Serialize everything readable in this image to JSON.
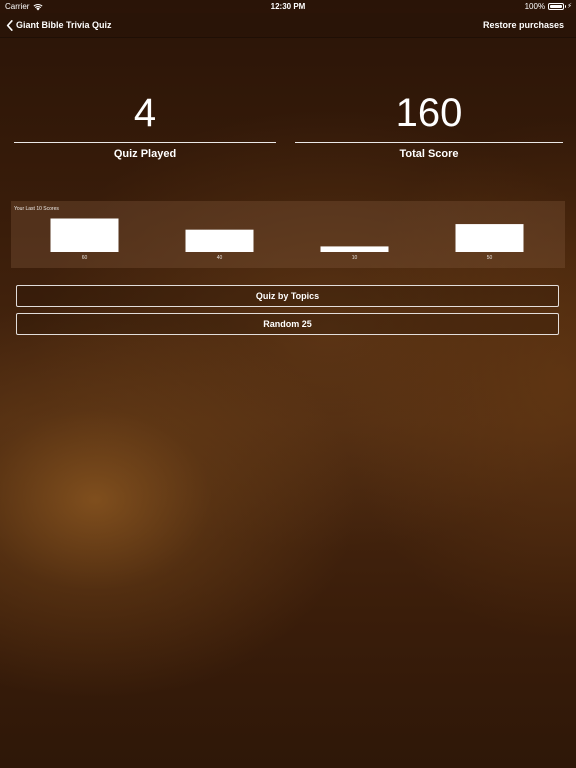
{
  "status_bar": {
    "carrier": "Carrier",
    "time": "12:30 PM",
    "battery": "100%"
  },
  "nav": {
    "back_label": "Giant Bible Trivia Quiz",
    "action_label": "Restore purchases"
  },
  "stats": {
    "quiz_played": {
      "value": "4",
      "label": "Quiz Played"
    },
    "total_score": {
      "value": "160",
      "label": "Total Score"
    }
  },
  "scores_panel": {
    "title": "Your Last 10 Scores"
  },
  "chart_data": {
    "type": "bar",
    "title": "Your Last 10 Scores",
    "categories": [
      "60",
      "40",
      "10",
      "50"
    ],
    "values": [
      60,
      40,
      10,
      50
    ],
    "xlabel": "",
    "ylabel": "",
    "ylim": [
      0,
      60
    ],
    "bar_color": "#ffffff"
  },
  "buttons": {
    "quiz_by_topics": "Quiz by Topics",
    "random_25": "Random 25"
  },
  "icons": {
    "back": "chevron-left-icon",
    "wifi": "wifi-icon",
    "battery": "battery-icon",
    "charging": "bolt-icon"
  },
  "colors": {
    "text": "#ffffff",
    "background": "#3a1d0a"
  }
}
